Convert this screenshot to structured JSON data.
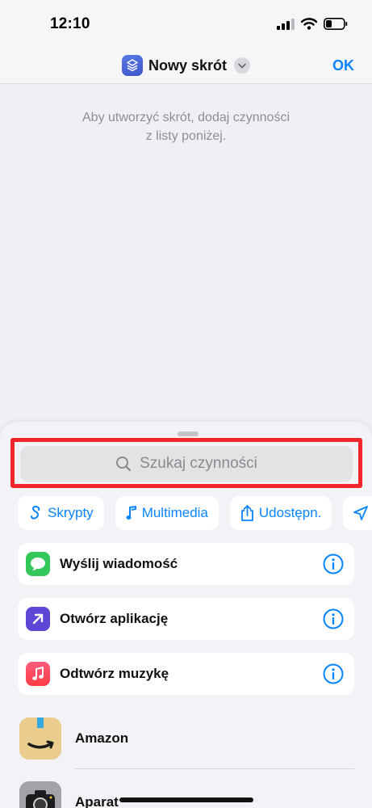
{
  "status_bar": {
    "time": "12:10"
  },
  "nav": {
    "title": "Nowy skrót",
    "ok_label": "OK"
  },
  "empty_state": {
    "line1": "Aby utworzyć skrót, dodaj czynności",
    "line2": "z listy poniżej."
  },
  "sheet": {
    "search_placeholder": "Szukaj czynności",
    "chips": [
      {
        "label": "Skrypty",
        "icon": "scripts-icon"
      },
      {
        "label": "Multimedia",
        "icon": "music-note-icon"
      },
      {
        "label": "Udostępn.",
        "icon": "share-icon"
      },
      {
        "label": "",
        "icon": "location-arrow-icon"
      }
    ],
    "suggestions": [
      {
        "label": "Wyślij wiadomość",
        "icon": "messages-icon"
      },
      {
        "label": "Otwórz aplikację",
        "icon": "open-app-icon"
      },
      {
        "label": "Odtwórz muzykę",
        "icon": "music-app-icon"
      }
    ],
    "apps": [
      {
        "label": "Amazon",
        "icon": "amazon-icon"
      },
      {
        "label": "Aparat",
        "icon": "camera-icon"
      }
    ]
  },
  "colors": {
    "accent": "#0a84ff",
    "highlight": "#f0262b",
    "messages": "#34c759",
    "open_app": "#5e47d6",
    "music": "#fc3c44"
  }
}
